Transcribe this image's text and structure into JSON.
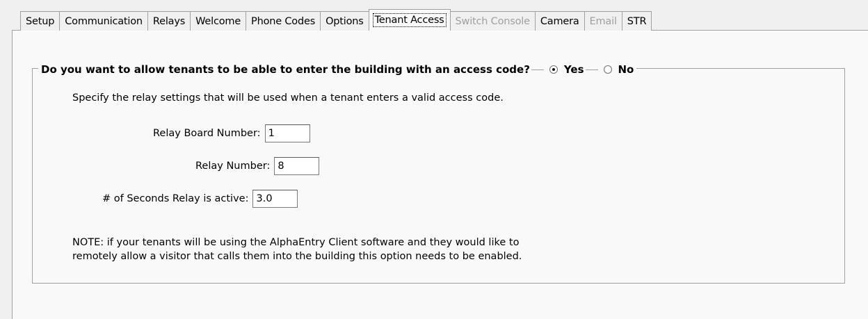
{
  "tabs": [
    {
      "label": "Setup",
      "state": "normal"
    },
    {
      "label": "Communication",
      "state": "normal"
    },
    {
      "label": "Relays",
      "state": "normal"
    },
    {
      "label": "Welcome",
      "state": "normal"
    },
    {
      "label": "Phone Codes",
      "state": "normal"
    },
    {
      "label": "Options",
      "state": "normal"
    },
    {
      "label": "Tenant Access",
      "state": "active"
    },
    {
      "label": "Switch Console",
      "state": "disabled"
    },
    {
      "label": "Camera",
      "state": "normal"
    },
    {
      "label": "Email",
      "state": "disabled"
    },
    {
      "label": "STR",
      "state": "normal"
    }
  ],
  "group": {
    "question": "Do you want to allow tenants to be able to enter the building with an access code?",
    "yes_label": "Yes",
    "no_label": "No",
    "selected": "Yes"
  },
  "instruction": "Specify the relay settings that will be used when a tenant enters a valid access code.",
  "fields": {
    "relay_board_label": "Relay Board Number:",
    "relay_board_value": "1",
    "relay_number_label": "Relay Number:",
    "relay_number_value": "8",
    "seconds_label": "# of Seconds Relay is active:",
    "seconds_value": "3.0"
  },
  "note": {
    "line1": "NOTE: if your tenants will be using the AlphaEntry Client software and they would like to",
    "line2": "remotely allow a visitor that calls them into the building this option needs to be enabled."
  }
}
